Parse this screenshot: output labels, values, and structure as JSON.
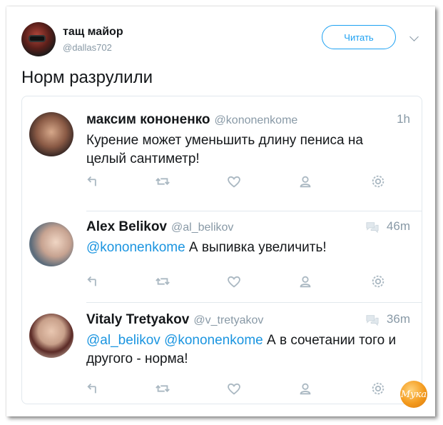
{
  "author": {
    "name": "тащ майор",
    "handle": "@dallas702",
    "follow_label": "Читать"
  },
  "tweet": {
    "text": "Норм разрулили"
  },
  "replies": [
    {
      "name": "максим кононенко",
      "handle": "@kononenkome",
      "time": "1h",
      "text": "Курение может уменьшить длину пениса на целый сантиметр!"
    },
    {
      "name": "Alex Belikov",
      "handle": "@al_belikov",
      "time": "46m",
      "mention": "@kononenkome",
      "text": " А выпивка увеличить!"
    },
    {
      "name": "Vitaly Tretyakov",
      "handle": "@v_tretyakov",
      "time": "36m",
      "mention": "@al_belikov @kononenkome",
      "text": " А в сочетании того и другого - норма!"
    }
  ],
  "action_icons": [
    "reply-icon",
    "retweet-icon",
    "like-icon",
    "profile-icon",
    "settings-icon"
  ],
  "watermark_text": "Мука",
  "colors": {
    "accent": "#1da1f2",
    "mention": "#1b95e0",
    "muted": "#8899a6",
    "text": "#14171a",
    "border": "#e1e8ed"
  }
}
